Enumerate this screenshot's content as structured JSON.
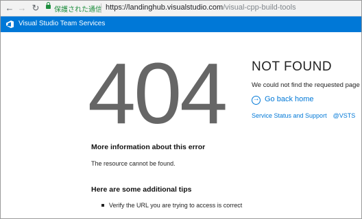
{
  "browser": {
    "security_label": "保護された通信",
    "url_host": "https://landinghub.visualstudio.com",
    "url_path": "/visual-cpp-build-tools"
  },
  "header": {
    "title": "Visual Studio Team Services"
  },
  "error": {
    "code": "404",
    "title": "NOT FOUND",
    "description": "We could not find the requested page",
    "go_home_label": "Go back home",
    "status_link": "Service Status and Support",
    "twitter_link": "@VSTS"
  },
  "more_info": {
    "heading": "More information about this error",
    "text": "The resource cannot be found."
  },
  "tips": {
    "heading": "Here are some additional tips",
    "items": [
      "Verify the URL you are trying to access is correct"
    ]
  },
  "colors": {
    "accent": "#0078d7",
    "secure_green": "#1e8e3e",
    "code_gray": "#666666"
  }
}
